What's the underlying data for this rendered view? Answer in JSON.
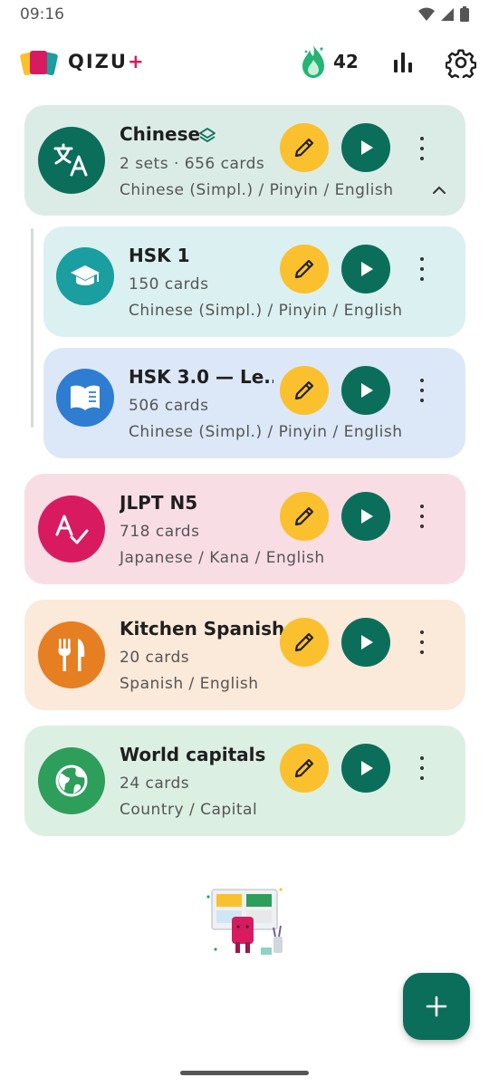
{
  "status_bar": {
    "time": "09:16"
  },
  "app_bar": {
    "app_name": "QIZU",
    "app_plus": "+",
    "streak_count": "42"
  },
  "colors": {
    "accent": "#0b6e5a",
    "edit": "#fbc02d",
    "brand_plus": "#d81b60"
  },
  "decks": [
    {
      "title": "Chinese",
      "sub": "2 sets · 656 cards",
      "langs": "Chinese (Simpl.) / Pinyin / English",
      "icon": "translate-icon",
      "bg": "#dbece6",
      "avatar": "#0b6e5a",
      "is_group": true,
      "expanded": true
    },
    {
      "title": "HSK 1",
      "sub": "150 cards",
      "langs": "Chinese (Simpl.) / Pinyin / English",
      "icon": "graduation-cap-icon",
      "bg": "#dbf0f0",
      "avatar": "#1a9ea0"
    },
    {
      "title": "HSK 3.0 — Le...",
      "sub": "506 cards",
      "langs": "Chinese (Simpl.) / Pinyin / English",
      "icon": "book-icon",
      "bg": "#dce8f7",
      "avatar": "#2e7dd1"
    },
    {
      "title": "JLPT N5",
      "sub": "718 cards",
      "langs": "Japanese / Kana / English",
      "icon": "spellcheck-icon",
      "bg": "#f9dde5",
      "avatar": "#d81b60"
    },
    {
      "title": "Kitchen Spanish",
      "sub": "20 cards",
      "langs": "Spanish / English",
      "icon": "utensils-icon",
      "bg": "#fbe9d9",
      "avatar": "#e67e22"
    },
    {
      "title": "World capitals",
      "sub": "24 cards",
      "langs": "Country / Capital",
      "icon": "globe-icon",
      "bg": "#dcefe3",
      "avatar": "#2e9e5b"
    }
  ]
}
